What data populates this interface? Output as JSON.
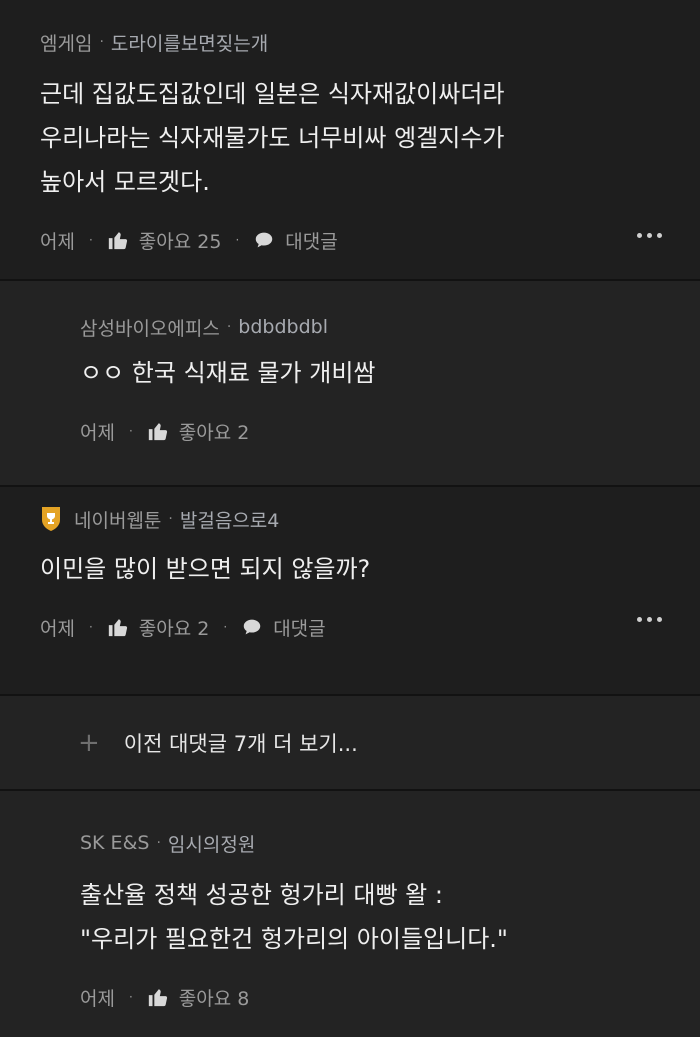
{
  "comments": [
    {
      "author_badge": "엠게임",
      "author": "도라이를보면짖는개",
      "text": "근데 집값도집값인데 일본은 식자재값이싸더라\n우리나라는 식자재물가도 너무비싸 엥겔지수가\n높아서 모르겟다.",
      "time": "어제",
      "likes_label": "좋아요 25",
      "reply_label": "대댓글"
    },
    {
      "author_badge": "삼성바이오에피스",
      "author": "bdbdbdbl",
      "text": "ㅇㅇ 한국 식재료 물가 개비쌈",
      "time": "어제",
      "likes_label": "좋아요 2"
    },
    {
      "author_badge": "네이버웹툰",
      "author": "발걸음으로4",
      "text": "이민을 많이 받으면 되지 않을까?",
      "time": "어제",
      "likes_label": "좋아요 2",
      "reply_label": "대댓글"
    },
    {
      "author_badge": "SK E&S",
      "author": "임시의정원",
      "text": "출산율 정책 성공한 헝가리 대빵 왈 :\n\"우리가 필요한건 헝가리의 아이들입니다.\"",
      "time": "어제",
      "likes_label": "좋아요 8"
    }
  ],
  "more_replies": {
    "label": "이전 대댓글 7개 더 보기..."
  },
  "icons": {
    "like": "thumbs-up-icon",
    "reply": "speech-bubble-icon",
    "badge": "trophy-icon",
    "more": "more-dots-icon",
    "expand": "plus-icon"
  },
  "colors": {
    "background": "#1e1e1e",
    "reply_background": "#232323",
    "badge": "#e4a325"
  },
  "separator": "·"
}
